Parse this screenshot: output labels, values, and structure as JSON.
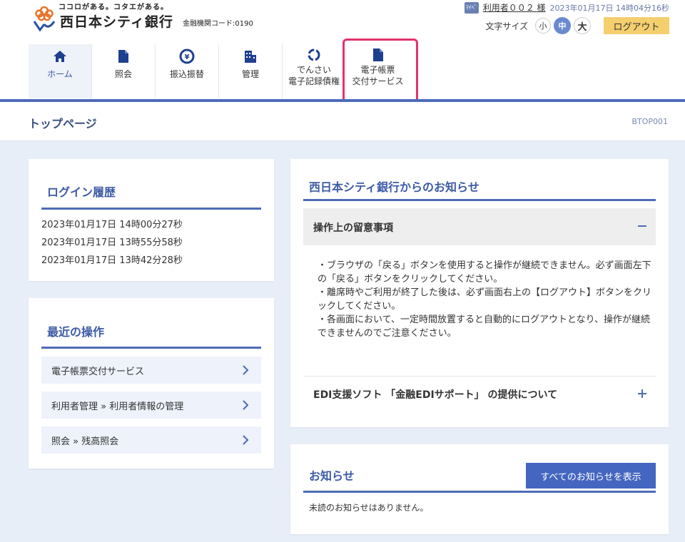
{
  "header": {
    "tagline": "ココロがある。コタエがある。",
    "bank_name": "西日本シティ銀行",
    "bank_code": "金融機関コード:0190",
    "user_icon_text": "ﾏｲﾍﾟ",
    "user_name": "利用者００２ 様",
    "datetime": "2023年01月17日 14時04分16秒",
    "font_size_label": "文字サイズ",
    "font_sizes": [
      "小",
      "中",
      "大"
    ],
    "logout": "ログアウト"
  },
  "nav": {
    "items": [
      {
        "label": "ホーム",
        "icon": "home-icon"
      },
      {
        "label": "照会",
        "icon": "document-icon"
      },
      {
        "label": "振込振替",
        "icon": "transfer-icon"
      },
      {
        "label": "管理",
        "icon": "building-icon"
      },
      {
        "label_line1": "でんさい",
        "label_line2": "電子記録債権",
        "icon": "densai-icon"
      },
      {
        "label_line1": "電子帳票",
        "label_line2": "交付サービス",
        "icon": "document-icon"
      }
    ]
  },
  "page": {
    "title": "トップページ",
    "code": "BTOP001"
  },
  "login_history": {
    "heading": "ログイン履歴",
    "entries": [
      "2023年01月17日 14時00分27秒",
      "2023年01月17日 13時55分58秒",
      "2023年01月17日 13時42分28秒"
    ]
  },
  "recent_ops": {
    "heading": "最近の操作",
    "items": [
      "電子帳票交付サービス",
      "利用者管理 » 利用者情報の管理",
      "照会 » 残高照会"
    ]
  },
  "bank_notices": {
    "heading": "西日本シティ銀行からのお知らせ",
    "section1_title": "操作上の留意事項",
    "section1_lines": [
      "・ブラウザの「戻る」ボタンを使用すると操作が継続できません。必ず画面左下の「戻る」ボタンをクリックしてください。",
      "・離席時やご利用が終了した後は、必ず画面右上の【ログアウト】ボタンをクリックしてください。",
      "・各画面において、一定時間放置すると自動的にログアウトとなり、操作が継続できませんのでご注意ください。"
    ],
    "section2_title": "EDI支援ソフト 「金融EDIサポート」 の提供について"
  },
  "notices": {
    "heading": "お知らせ",
    "show_all": "すべてのお知らせを表示",
    "empty": "未読のお知らせはありません。"
  },
  "colors": {
    "accent": "#4e6bb8",
    "heading": "#3d5aa5",
    "highlight": "#e2336a",
    "logout": "#f5cf6e"
  }
}
